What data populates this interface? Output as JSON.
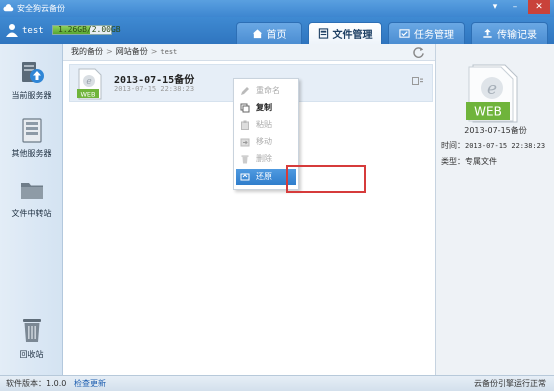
{
  "window": {
    "title": "安全狗云备份"
  },
  "user": {
    "name": "test",
    "quota_text": "1.26GB/2.00GB",
    "quota_fraction": 0.63
  },
  "tabs": [
    {
      "label": "首页",
      "icon": "home-icon"
    },
    {
      "label": "文件管理",
      "icon": "file-manage-icon",
      "active": true
    },
    {
      "label": "任务管理",
      "icon": "task-icon"
    },
    {
      "label": "传输记录",
      "icon": "upload-icon"
    }
  ],
  "sidebar": {
    "items": [
      {
        "label": "当前服务器",
        "icon": "server-upload-icon"
      },
      {
        "label": "其他服务器",
        "icon": "server-rack-icon"
      },
      {
        "label": "文件中转站",
        "icon": "folder-icon"
      }
    ],
    "recycle": {
      "label": "回收站",
      "icon": "trash-icon"
    }
  },
  "breadcrumb": {
    "items": [
      "我的备份",
      "网站备份",
      "test"
    ]
  },
  "file": {
    "name": "2013-07-15备份",
    "time": "2013-07-15 22:38:23",
    "badge": "WEB"
  },
  "context_menu": {
    "items": [
      {
        "label": "重命名",
        "icon": "pencil-icon",
        "state": "disabled"
      },
      {
        "label": "复制",
        "icon": "copy-icon",
        "state": "enabled"
      },
      {
        "label": "粘贴",
        "icon": "paste-icon",
        "state": "disabled"
      },
      {
        "label": "移动",
        "icon": "move-icon",
        "state": "disabled"
      },
      {
        "label": "删除",
        "icon": "delete-icon",
        "state": "disabled"
      },
      {
        "label": "还原",
        "icon": "restore-icon",
        "state": "selected"
      }
    ]
  },
  "detail": {
    "badge": "WEB",
    "name": "2013-07-15备份",
    "time_label": "时间：",
    "time_value": "2013-07-15 22:38:23",
    "type_label": "类型：",
    "type_value": "专属文件"
  },
  "status": {
    "version": "软件版本：1.0.0",
    "update_link": "检查更新",
    "engine": "云备份引擎运行正常"
  },
  "colors": {
    "accent": "#3f8ad2",
    "selected": "#2f7dcc",
    "highlight": "#d63b3b"
  }
}
